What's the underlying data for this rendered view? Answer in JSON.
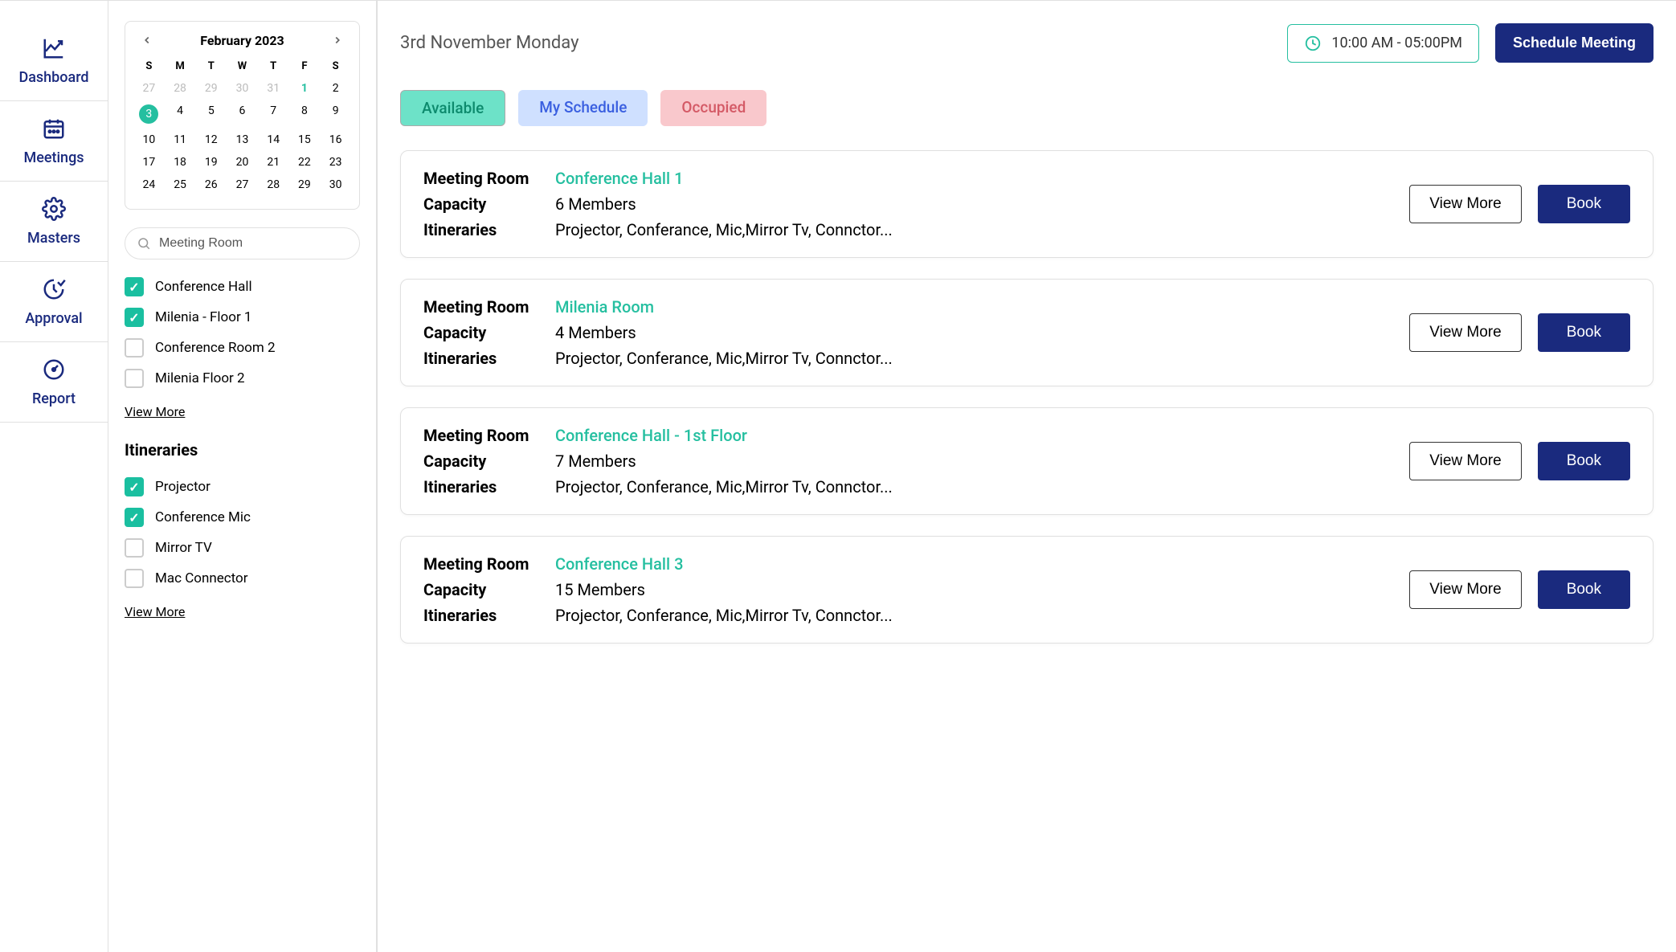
{
  "nav": {
    "items": [
      {
        "id": "dashboard",
        "label": "Dashboard",
        "icon": "chart"
      },
      {
        "id": "meetings",
        "label": "Meetings",
        "icon": "calendar"
      },
      {
        "id": "masters",
        "label": "Masters",
        "icon": "gear"
      },
      {
        "id": "approval",
        "label": "Approval",
        "icon": "clock-check"
      },
      {
        "id": "report",
        "label": "Report",
        "icon": "gauge"
      }
    ]
  },
  "calendar": {
    "title": "February 2023",
    "dow": [
      "S",
      "M",
      "T",
      "W",
      "T",
      "F",
      "S"
    ],
    "weeks": [
      [
        {
          "d": 27,
          "other": true
        },
        {
          "d": 28,
          "other": true
        },
        {
          "d": 29,
          "other": true
        },
        {
          "d": 30,
          "other": true
        },
        {
          "d": 31,
          "other": true
        },
        {
          "d": 1,
          "today": true
        },
        {
          "d": 2
        }
      ],
      [
        {
          "d": 3,
          "selected": true
        },
        {
          "d": 4
        },
        {
          "d": 5
        },
        {
          "d": 6
        },
        {
          "d": 7
        },
        {
          "d": 8
        },
        {
          "d": 9
        }
      ],
      [
        {
          "d": 10
        },
        {
          "d": 11
        },
        {
          "d": 12
        },
        {
          "d": 13
        },
        {
          "d": 14
        },
        {
          "d": 15
        },
        {
          "d": 16
        }
      ],
      [
        {
          "d": 17
        },
        {
          "d": 18
        },
        {
          "d": 19
        },
        {
          "d": 20
        },
        {
          "d": 21
        },
        {
          "d": 22
        },
        {
          "d": 23
        }
      ],
      [
        {
          "d": 24
        },
        {
          "d": 25
        },
        {
          "d": 26
        },
        {
          "d": 27
        },
        {
          "d": 28
        },
        {
          "d": 29
        },
        {
          "d": 30
        }
      ]
    ]
  },
  "search": {
    "value": "Meeting Room"
  },
  "room_filters": {
    "items": [
      {
        "label": "Conference Hall",
        "checked": true
      },
      {
        "label": "Milenia - Floor 1",
        "checked": true
      },
      {
        "label": "Conference Room 2",
        "checked": false
      },
      {
        "label": "Milenia Floor 2",
        "checked": false
      }
    ],
    "view_more": "View More"
  },
  "itineraries": {
    "title": "Itineraries",
    "items": [
      {
        "label": "Projector",
        "checked": true
      },
      {
        "label": "Conference Mic",
        "checked": true
      },
      {
        "label": "Mirror TV",
        "checked": false
      },
      {
        "label": "Mac Connector",
        "checked": false
      }
    ],
    "view_more": "View More"
  },
  "header": {
    "date": "3rd November Monday",
    "time_range": "10:00 AM - 05:00PM",
    "schedule_btn": "Schedule Meeting"
  },
  "tabs": {
    "available": "Available",
    "my_schedule": "My Schedule",
    "occupied": "Occupied"
  },
  "rooms": [
    {
      "name": "Conference Hall 1",
      "capacity": "6 Members",
      "itineraries": "Projector, Conferance, Mic,Mirror Tv, Connctor..."
    },
    {
      "name": "Milenia Room",
      "capacity": "4 Members",
      "itineraries": "Projector, Conferance, Mic,Mirror Tv, Connctor..."
    },
    {
      "name": "Conference Hall - 1st Floor",
      "capacity": "7 Members",
      "itineraries": "Projector, Conferance, Mic,Mirror Tv, Connctor..."
    },
    {
      "name": "Conference Hall 3",
      "capacity": "15 Members",
      "itineraries": "Projector, Conferance, Mic,Mirror Tv, Connctor..."
    }
  ],
  "labels": {
    "meeting_room": "Meeting Room",
    "capacity": "Capacity",
    "itineraries": "Itineraries",
    "view_more": "View More",
    "book": "Book"
  }
}
